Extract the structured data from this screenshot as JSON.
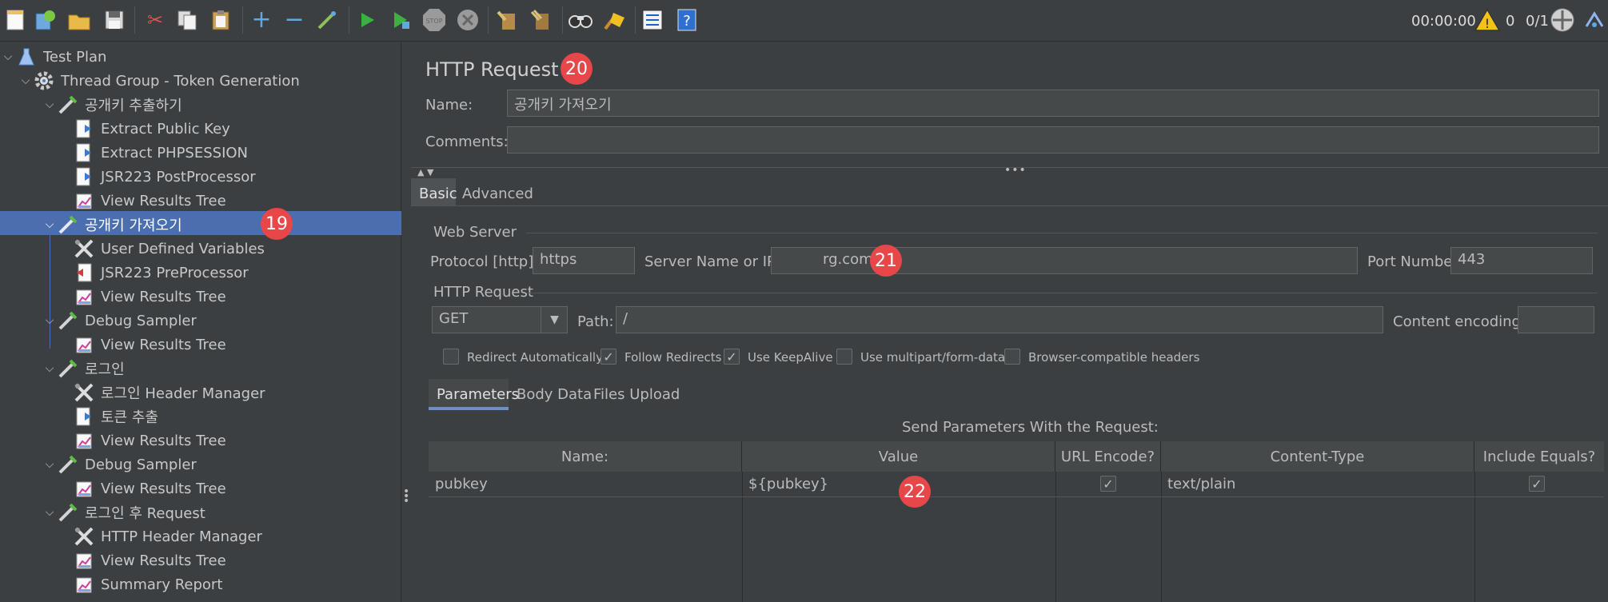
{
  "toolbar": {
    "icons": [
      "new-icon",
      "templates-icon",
      "open-icon",
      "save-icon",
      "cut-icon",
      "copy-icon",
      "paste-icon",
      "expand-icon",
      "collapse-icon",
      "toggle-icon",
      "start-icon",
      "start-no-pauses-icon",
      "stop-icon",
      "shutdown-icon",
      "clear-icon",
      "clear-all-icon",
      "search-icon",
      "reset-search-icon",
      "function-helper-icon",
      "help-icon"
    ],
    "timer": "00:00:00",
    "warnings": "0",
    "threads": "0/1"
  },
  "tree": {
    "items": [
      {
        "label": "Test Plan",
        "icon": "test-plan-icon"
      },
      {
        "label": "Thread Group - Token Generation",
        "icon": "gear-icon"
      },
      {
        "label": "공개키 추출하기",
        "icon": "sampler-icon"
      },
      {
        "label": "Extract Public Key",
        "icon": "extractor-icon"
      },
      {
        "label": "Extract PHPSESSION",
        "icon": "extractor-icon"
      },
      {
        "label": "JSR223 PostProcessor",
        "icon": "extractor-icon"
      },
      {
        "label": "View Results Tree",
        "icon": "listener-icon"
      },
      {
        "label": "공개키 가져오기",
        "icon": "sampler-icon",
        "badge": "19"
      },
      {
        "label": "User Defined Variables",
        "icon": "config-icon"
      },
      {
        "label": "JSR223 PreProcessor",
        "icon": "preprocessor-icon"
      },
      {
        "label": "View Results Tree",
        "icon": "listener-icon"
      },
      {
        "label": "Debug Sampler",
        "icon": "sampler-icon"
      },
      {
        "label": "View Results Tree",
        "icon": "listener-icon"
      },
      {
        "label": "로그인",
        "icon": "sampler-icon"
      },
      {
        "label": "로그인 Header Manager",
        "icon": "config-icon"
      },
      {
        "label": "토큰 추출",
        "icon": "extractor-icon"
      },
      {
        "label": "View Results Tree",
        "icon": "listener-icon"
      },
      {
        "label": "Debug Sampler",
        "icon": "sampler-icon"
      },
      {
        "label": "View Results Tree",
        "icon": "listener-icon"
      },
      {
        "label": "로그인 후 Request",
        "icon": "sampler-icon"
      },
      {
        "label": "HTTP Header Manager",
        "icon": "config-icon"
      },
      {
        "label": "View Results Tree",
        "icon": "listener-icon"
      },
      {
        "label": "Summary Report",
        "icon": "listener-icon"
      }
    ]
  },
  "main": {
    "title": "HTTP Request",
    "title_badge": "20",
    "name_label": "Name:",
    "name_value": "공개키 가져오기",
    "comments_label": "Comments:",
    "comments_value": "",
    "tabs": [
      "Basic",
      "Advanced"
    ],
    "web_server": {
      "legend": "Web Server",
      "protocol_label": "Protocol [http]:",
      "protocol_value": "https",
      "server_label": "Server Name or IP:",
      "server_value": "rg.com",
      "server_badge": "21",
      "port_label": "Port Number:",
      "port_value": "443"
    },
    "http_request": {
      "legend": "HTTP Request",
      "method": "GET",
      "path_label": "Path:",
      "path_value": "/",
      "encoding_label": "Content encoding:",
      "encoding_value": ""
    },
    "options": [
      {
        "label": "Redirect Automatically",
        "checked": false
      },
      {
        "label": "Follow Redirects",
        "checked": true
      },
      {
        "label": "Use KeepAlive",
        "checked": true
      },
      {
        "label": "Use multipart/form-data",
        "checked": false
      },
      {
        "label": "Browser-compatible headers",
        "checked": false
      }
    ],
    "sub_tabs": [
      "Parameters",
      "Body Data",
      "Files Upload"
    ],
    "params_caption": "Send Parameters With the Request:",
    "table": {
      "columns": [
        "Name:",
        "Value",
        "URL Encode?",
        "Content-Type",
        "Include Equals?"
      ],
      "rows": [
        {
          "name": "pubkey",
          "value": "${pubkey}",
          "url_encode": true,
          "content_type": "text/plain",
          "include_equals": true
        }
      ],
      "badge": "22"
    }
  },
  "colors": {
    "background": "#3c3f41",
    "selection": "#4b6eaf",
    "badge": "#e8474a",
    "field": "#45494a"
  }
}
